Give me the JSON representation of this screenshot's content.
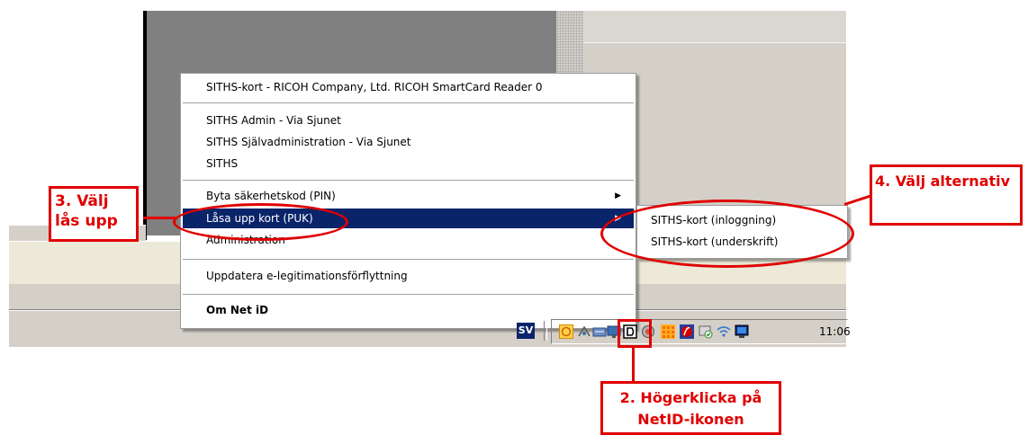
{
  "context_menu": {
    "reader": "SITHS-kort - RICOH Company, Ltd. RICOH SmartCard Reader 0",
    "item_admin": "SITHS Admin - Via Sjunet",
    "item_self_admin": "SITHS Självadministration - Via Sjunet",
    "item_siths": "SITHS",
    "item_change_pin": "Byta säkerhetskod (PIN)",
    "item_unlock": "Låsa upp kort (PUK)",
    "item_administration": "Administration",
    "item_update": "Uppdatera e-legitimationsförflyttning",
    "item_about": "Om Net iD"
  },
  "submenu": {
    "item_login": "SITHS-kort (inloggning)",
    "item_sign": "SITHS-kort (underskrift)"
  },
  "taskbar": {
    "language": "SV",
    "clock": "11:06"
  },
  "annotations": {
    "step3_line1": "3. Välj",
    "step3_line2": "lås upp",
    "step4": "4. Välj alternativ",
    "step2_line1": "2. Högerklicka på",
    "step2_line2": "NetID-ikonen"
  },
  "colors": {
    "annotation": "#e00000",
    "highlight": "#0a246a"
  },
  "icons": [
    "netid-icon",
    "shield-icon",
    "network-icon",
    "firewall-icon",
    "monitor-icon"
  ]
}
